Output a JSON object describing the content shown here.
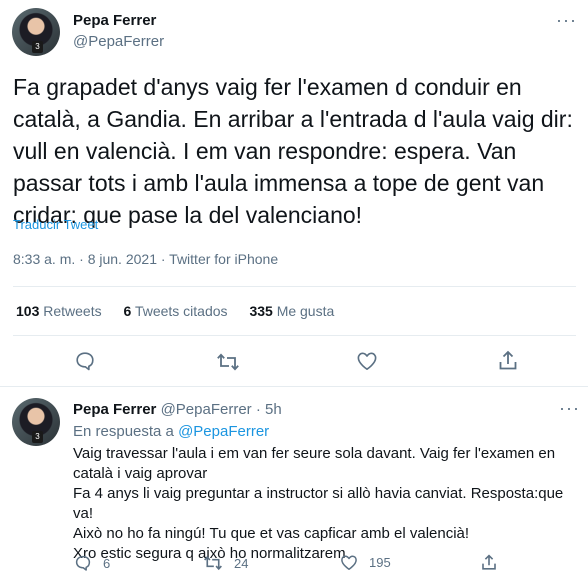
{
  "main_tweet": {
    "author_name": "Pepa Ferrer",
    "author_handle": "@PepaFerrer",
    "avatar_badge": "3",
    "text": "Fa grapadet d'anys vaig fer l'examen d conduir en català, a Gandia. En arribar a l'entrada d l'aula vaig dir: vull en valencià. I em van respondre: espera. Van passar tots i amb l'aula immensa a tope de gent van cridar: que pase la del valenciano!",
    "translate_label": "Traducir Tweet",
    "timestamp": "8:33 a. m. · 8 jun. 2021 · Twitter for iPhone",
    "stats": {
      "retweets_count": "103",
      "retweets_label": "Retweets",
      "quotes_count": "6",
      "quotes_label": "Tweets citados",
      "likes_count": "335",
      "likes_label": "Me gusta"
    },
    "actions": [
      "reply-icon",
      "retweet-icon",
      "like-icon",
      "share-icon"
    ]
  },
  "reply_tweet": {
    "author_name": "Pepa Ferrer",
    "author_handle_time": "@PepaFerrer · 5h",
    "avatar_badge": "3",
    "in_reply_prefix": "En respuesta a",
    "in_reply_handle": "@PepaFerrer",
    "lines": [
      "Vaig travessar l'aula i em van fer seure sola davant. Vaig fer l'examen en",
      "català i vaig aprovar",
      "Fa 4 anys li vaig preguntar a instructor si allò havia canviat. Resposta:que va!",
      "Això no ho fa ningú! Tu que et vas capficar amb el valencià!",
      "Xro estic segura q això ho normalitzarem"
    ],
    "reply_count": "6",
    "retweet_count": "24",
    "like_count": "195"
  },
  "more_glyph": "···"
}
